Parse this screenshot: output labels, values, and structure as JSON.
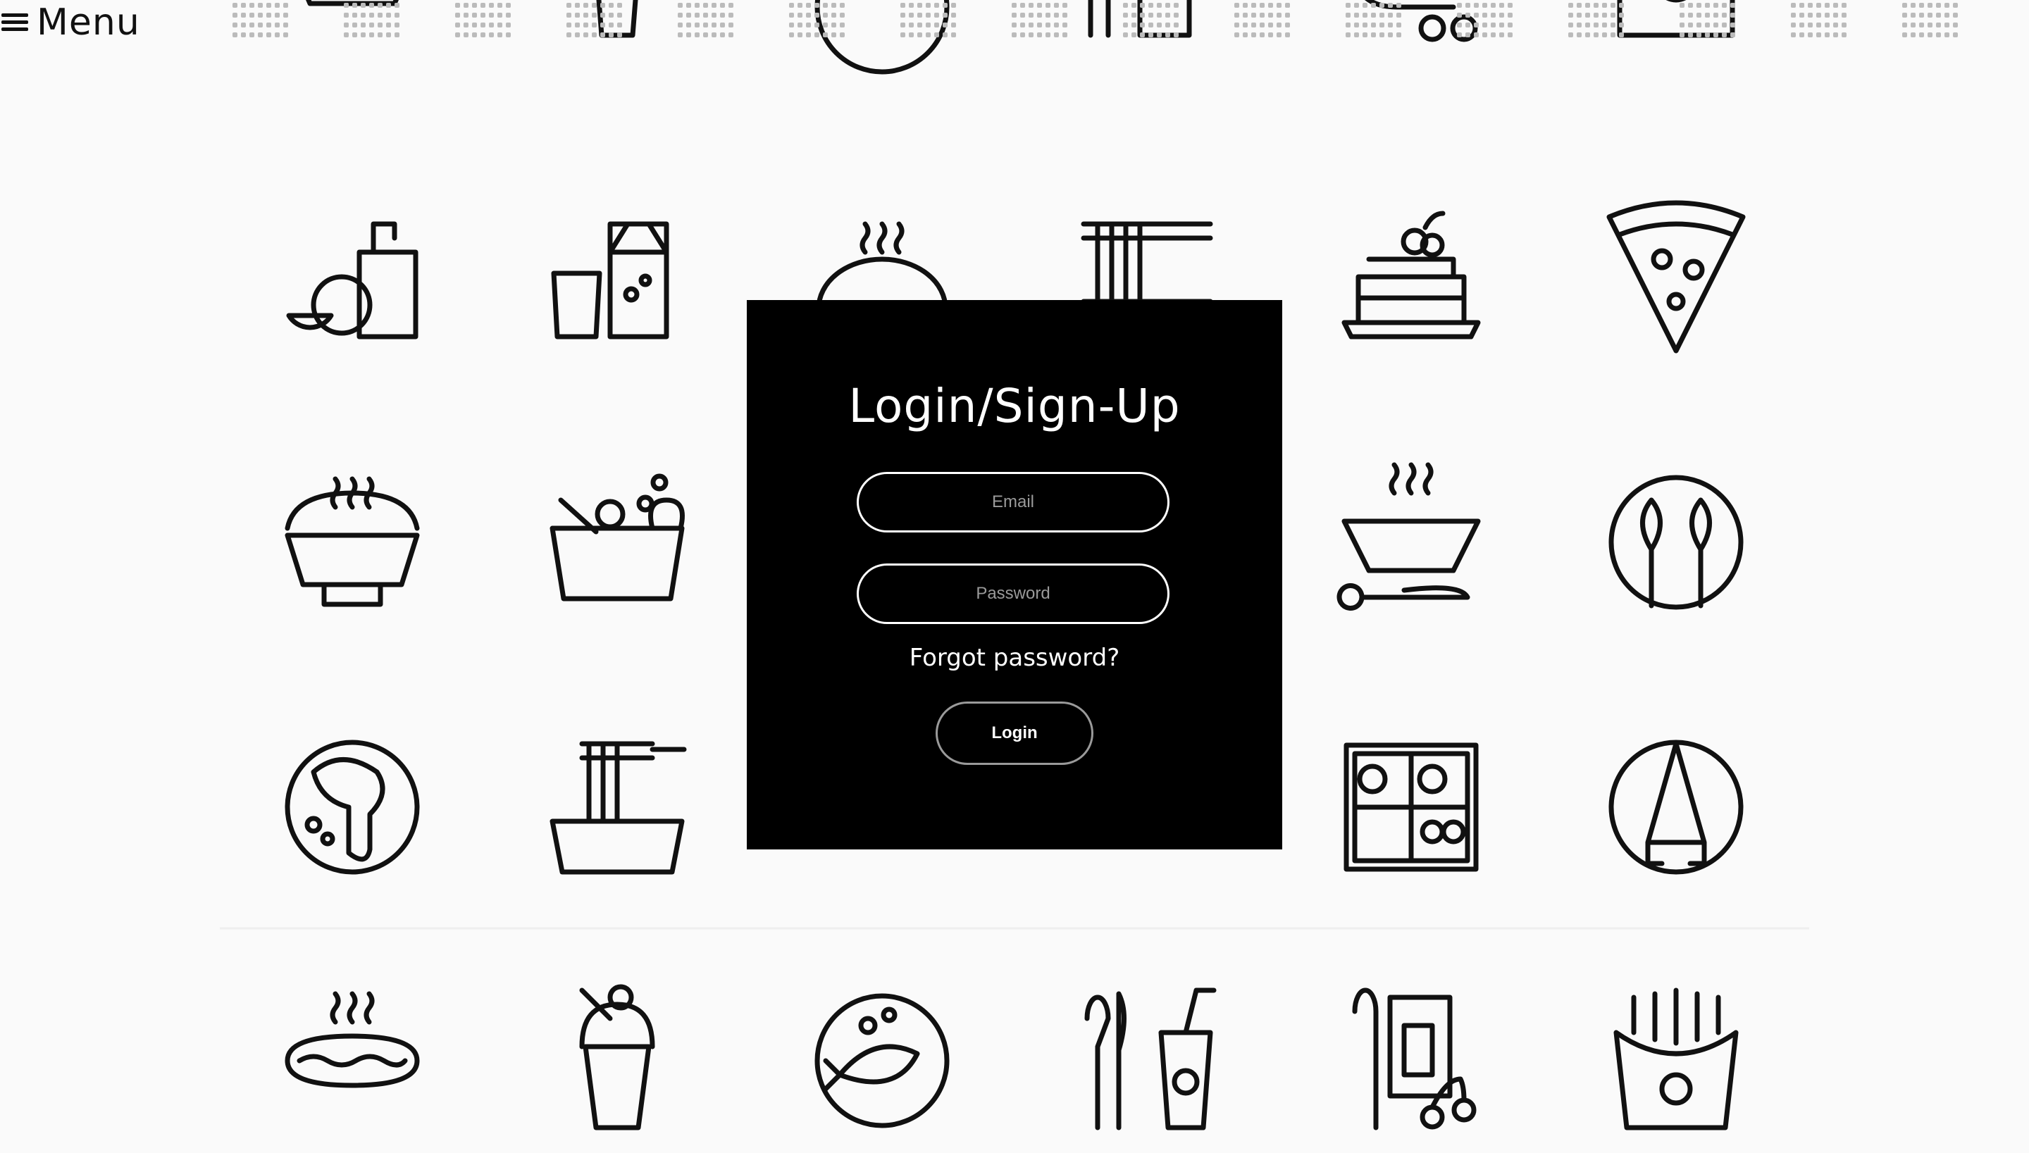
{
  "nav": {
    "menu_label": "Menu",
    "menu_icon": "hamburger-icon"
  },
  "login": {
    "title": "Login/Sign-Up",
    "email_placeholder": "Email",
    "email_value": "",
    "password_placeholder": "Password",
    "password_value": "",
    "forgot_label": "Forgot password?",
    "login_label": "Login"
  },
  "background": {
    "icons": [
      [
        "dish-icon",
        "cup-icon",
        "plate-icon",
        "utensils-icon",
        "cart-icon",
        "crown-icon"
      ],
      [
        "juice-orange-icon",
        "milk-carton-icon",
        "pie-icon",
        "noodles-icon",
        "pancakes-icon",
        "pizza-slice-icon"
      ],
      [
        "rice-bowl-icon",
        "salad-bowl-icon",
        "",
        "",
        "soup-bowl-icon",
        "wheat-icon"
      ],
      [
        "steak-plate-icon",
        "spaghetti-icon",
        "",
        "",
        "bento-box-icon",
        "ice-cream-plate-icon"
      ],
      [
        "hot-dog-icon",
        "milkshake-icon",
        "fish-plate-icon",
        "cutlery-drink-icon",
        "jam-cherry-icon",
        "fries-icon"
      ]
    ]
  },
  "colors": {
    "background": "#fafafa",
    "modal": "#000000",
    "text": "#ffffff",
    "icon_stroke": "#111111",
    "placeholder": "#9a9a9a"
  }
}
